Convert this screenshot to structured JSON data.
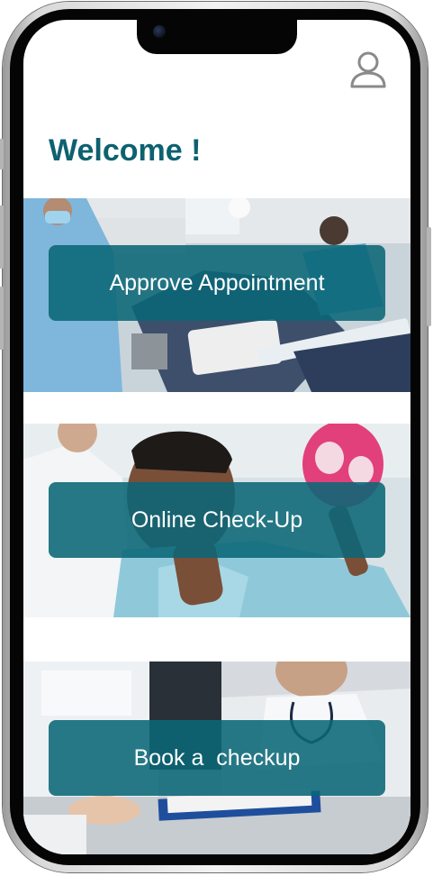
{
  "header": {
    "welcome_text": "Welcome !",
    "profile_icon": "user-profile-icon"
  },
  "menu": {
    "items": [
      {
        "label": "Approve Appointment",
        "image": "dental-clinic-team-photo"
      },
      {
        "label": "Online Check-Up",
        "image": "smiling-patient-with-mirror-photo"
      },
      {
        "label": "Book a  checkup",
        "image": "doctor-writing-on-clipboard-photo"
      }
    ]
  },
  "colors": {
    "accent": "#0d6170",
    "button_overlay": "#0a6676",
    "text_on_button": "#ffffff"
  }
}
